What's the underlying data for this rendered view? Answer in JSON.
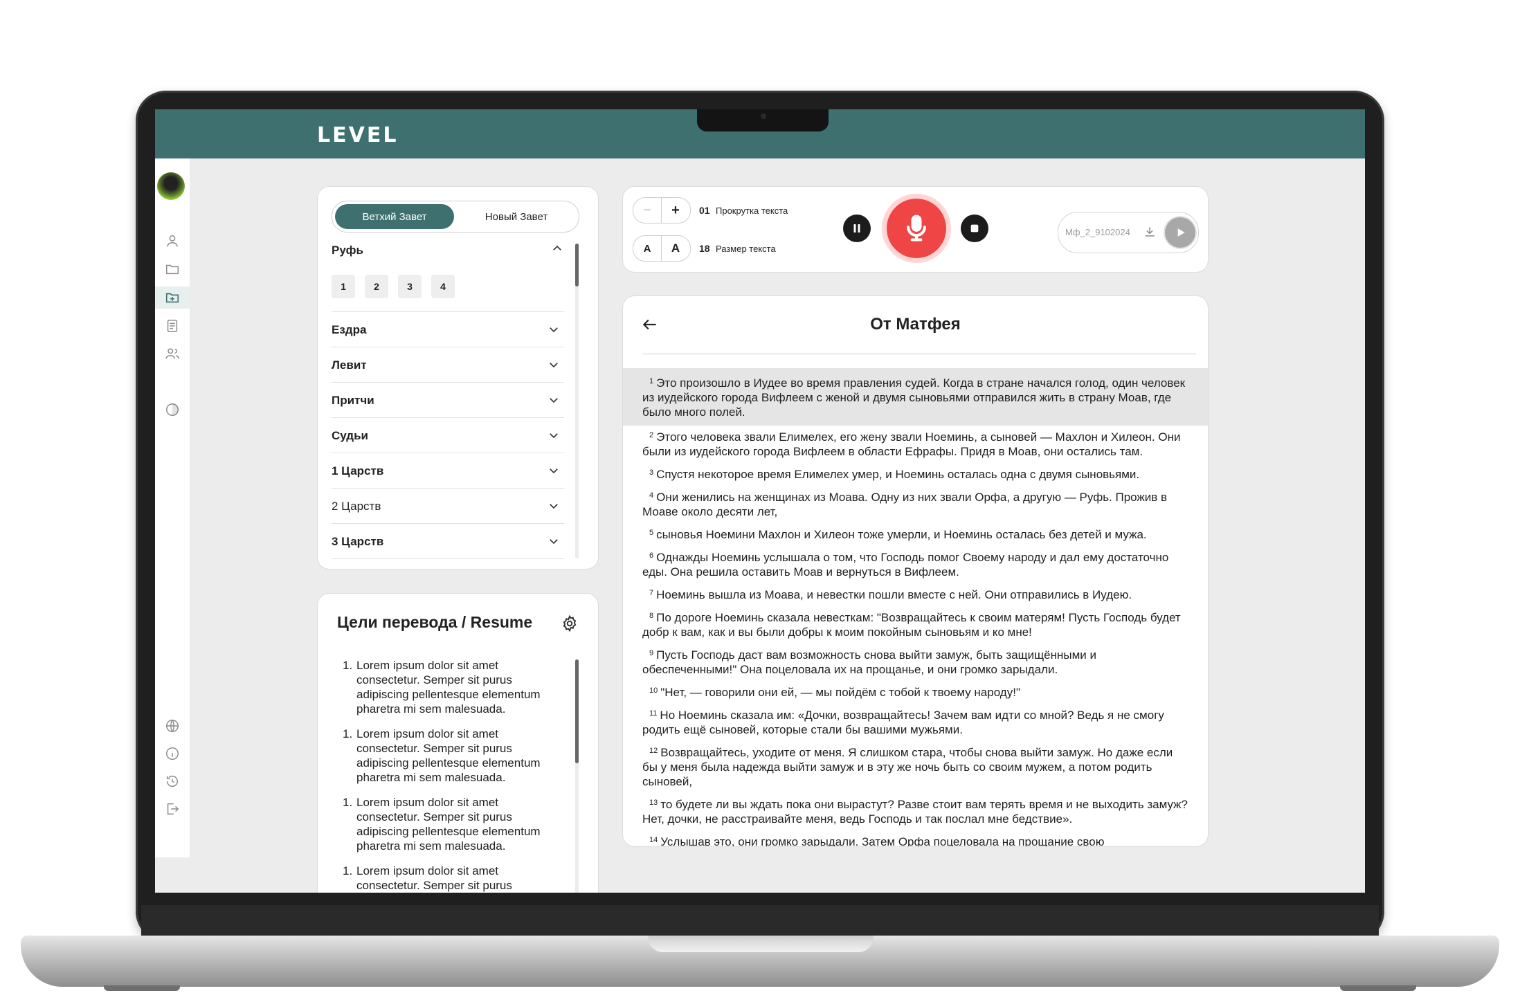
{
  "app": {
    "logo": "LEVEL"
  },
  "testament_tabs": {
    "active": "Ветхий Завет",
    "inactive": "Новый Завет"
  },
  "books": {
    "current": {
      "name": "Руфь",
      "chapters": [
        "1",
        "2",
        "3",
        "4"
      ]
    },
    "list": [
      {
        "name": "Ездра",
        "bold": true
      },
      {
        "name": "Левит",
        "bold": true
      },
      {
        "name": "Притчи",
        "bold": true
      },
      {
        "name": "Судьи",
        "bold": true
      },
      {
        "name": "1 Царств",
        "bold": true
      },
      {
        "name": "2 Царств",
        "bold": false
      },
      {
        "name": "3 Царств",
        "bold": true
      }
    ]
  },
  "goals": {
    "title": "Цели перевода / Resume",
    "items": [
      {
        "num": "1.",
        "text": "Lorem ipsum dolor sit amet consectetur. Semper sit purus adipiscing pellentesque elementum pharetra mi sem malesuada."
      },
      {
        "num": "1.",
        "text": "Lorem ipsum dolor sit amet consectetur. Semper sit purus adipiscing pellentesque elementum pharetra mi sem malesuada."
      },
      {
        "num": "1.",
        "text": "Lorem ipsum dolor sit amet consectetur. Semper sit purus adipiscing pellentesque elementum pharetra mi sem malesuada."
      },
      {
        "num": "1.",
        "text": "Lorem ipsum dolor sit amet consectetur. Semper sit purus"
      }
    ]
  },
  "toolbar": {
    "scroll_value": "01",
    "scroll_label": "Прокрутка текста",
    "scroll_minus": "−",
    "scroll_plus": "+",
    "size_value": "18",
    "size_label": "Размер текста",
    "size_small": "A",
    "size_large": "A",
    "audio_file": "Мф_2_9102024"
  },
  "reader": {
    "title": "От Матфея",
    "verses": [
      {
        "n": "1",
        "text": "Это произошло в Иудее во время правления судей. Когда в стране начался голод, один человек из иудейского города Вифлеем с женой и двумя сыновьями отправился жить в страну Моав, где было много полей."
      },
      {
        "n": "2",
        "text": "Этого человека звали Елимелех, его жену звали Ноеминь, а сыновей — Махлон и Хилеон. Они были из иудейского города Вифлеем в области Ефрафы. Придя в Моав, они остались там."
      },
      {
        "n": "3",
        "text": "Спустя некоторое время Елимелех умер, и Ноеминь осталась одна с двумя сыновьями."
      },
      {
        "n": "4",
        "text": "Они женились на женщинах из Моава. Одну из них звали Орфа, а другую — Руфь. Прожив в Моаве около десяти лет,"
      },
      {
        "n": "5",
        "text": "сыновья Ноемини Махлон и Хилеон тоже умерли, и Ноеминь осталась без детей и мужа."
      },
      {
        "n": "6",
        "text": "Однажды Ноеминь услышала о том, что Господь помог Своему народу и дал ему достаточно еды. Она решила оставить Моав и вернуться в Вифлеем."
      },
      {
        "n": "7",
        "text": "Ноеминь вышла из Моава, и невестки пошли вместе с ней. Они отправились в Иудею."
      },
      {
        "n": "8",
        "text": "По дороге Ноеминь сказала невесткам: \"Возвращайтесь к своим матерям! Пусть Господь будет добр к вам, как и вы были добры к моим покойным сыновьям и ко мне!"
      },
      {
        "n": "9",
        "text": "Пусть Господь даст вам возможность снова выйти замуж, быть защищёнными и обеспеченными!\" Она поцеловала их на прощанье, и они громко зарыдали."
      },
      {
        "n": "10",
        "text": "\"Нет, — говорили они ей, — мы пойдём с тобой к твоему народу!\""
      },
      {
        "n": "11",
        "text": "Но Ноеминь сказала им: «Дочки, возвращайтесь! Зачем вам идти со мной? Ведь я не смогу родить ещё сыновей, которые стали бы вашими мужьями."
      },
      {
        "n": "12",
        "text": "Возвращайтесь, уходите от меня. Я слишком стара, чтобы снова выйти замуж. Но даже если бы у меня была надежда выйти замуж и в эту же ночь быть со своим мужем, а потом родить сыновей,"
      },
      {
        "n": "13",
        "text": "то будете ли вы ждать пока они вырастут? Разве стоит вам терять время и не выходить замуж? Нет, дочки, не расстраивайте меня, ведь Господь и так послал мне бедствие»."
      },
      {
        "n": "14",
        "text": "Услышав это, они громко зарыдали. Затем Орфа поцеловала на прощание свою"
      }
    ]
  },
  "colors": {
    "brand": "#3f7070",
    "record": "#f04545",
    "background": "#ececec"
  }
}
